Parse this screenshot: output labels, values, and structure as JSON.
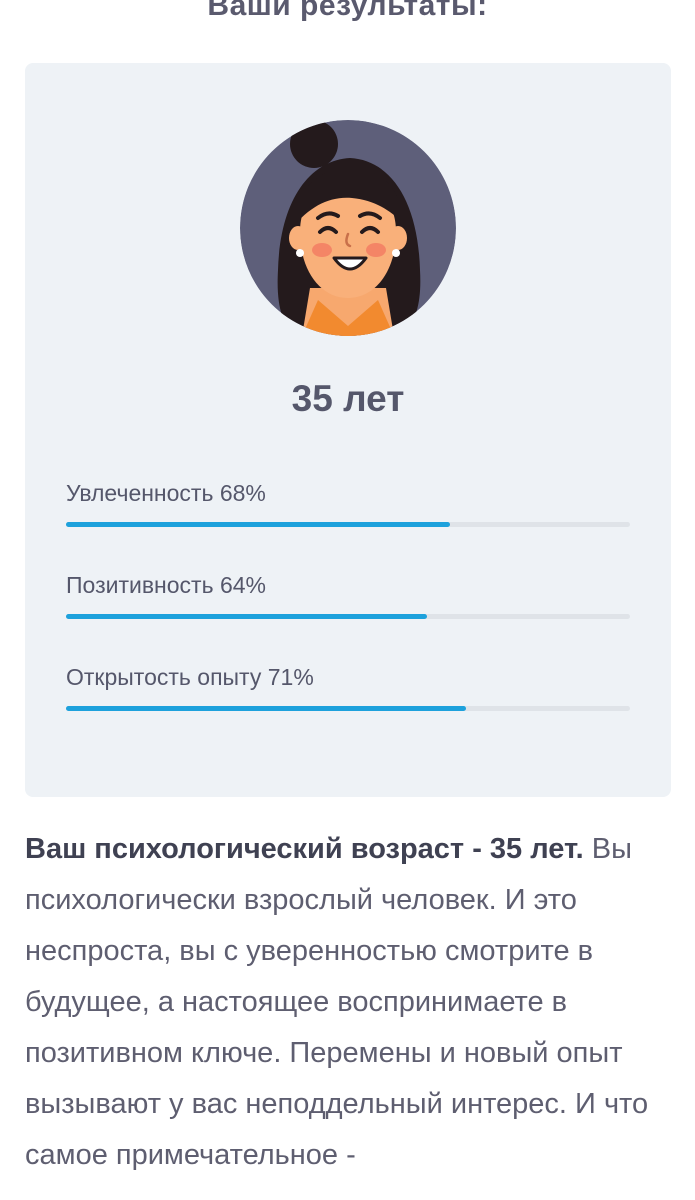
{
  "heading": "Ваши результаты:",
  "result": {
    "avatar_icon": "woman-avatar-icon",
    "age_title": "35 лет",
    "metrics": [
      {
        "label": "Увлеченность 68%",
        "value": 0.68
      },
      {
        "label": "Позитивность 64%",
        "value": 0.64
      },
      {
        "label": "Открытость опыту 71%",
        "value": 0.71
      }
    ]
  },
  "description": {
    "bold": "Ваш психологический возраст - 35 лет.",
    "text": " Вы психологически взрослый человек. И это неспроста, вы с уверенностью смотрите в будущее, а настоящее воспринимаете  в позитивном ключе. Перемены и новый опыт вызывают у вас неподдельный интерес. И что самое примечательное -"
  },
  "colors": {
    "card_background": "#eef2f6",
    "progress_fill": "#1da1dc",
    "progress_track": "#dfe3e8",
    "avatar_background": "#5e5f7a"
  }
}
